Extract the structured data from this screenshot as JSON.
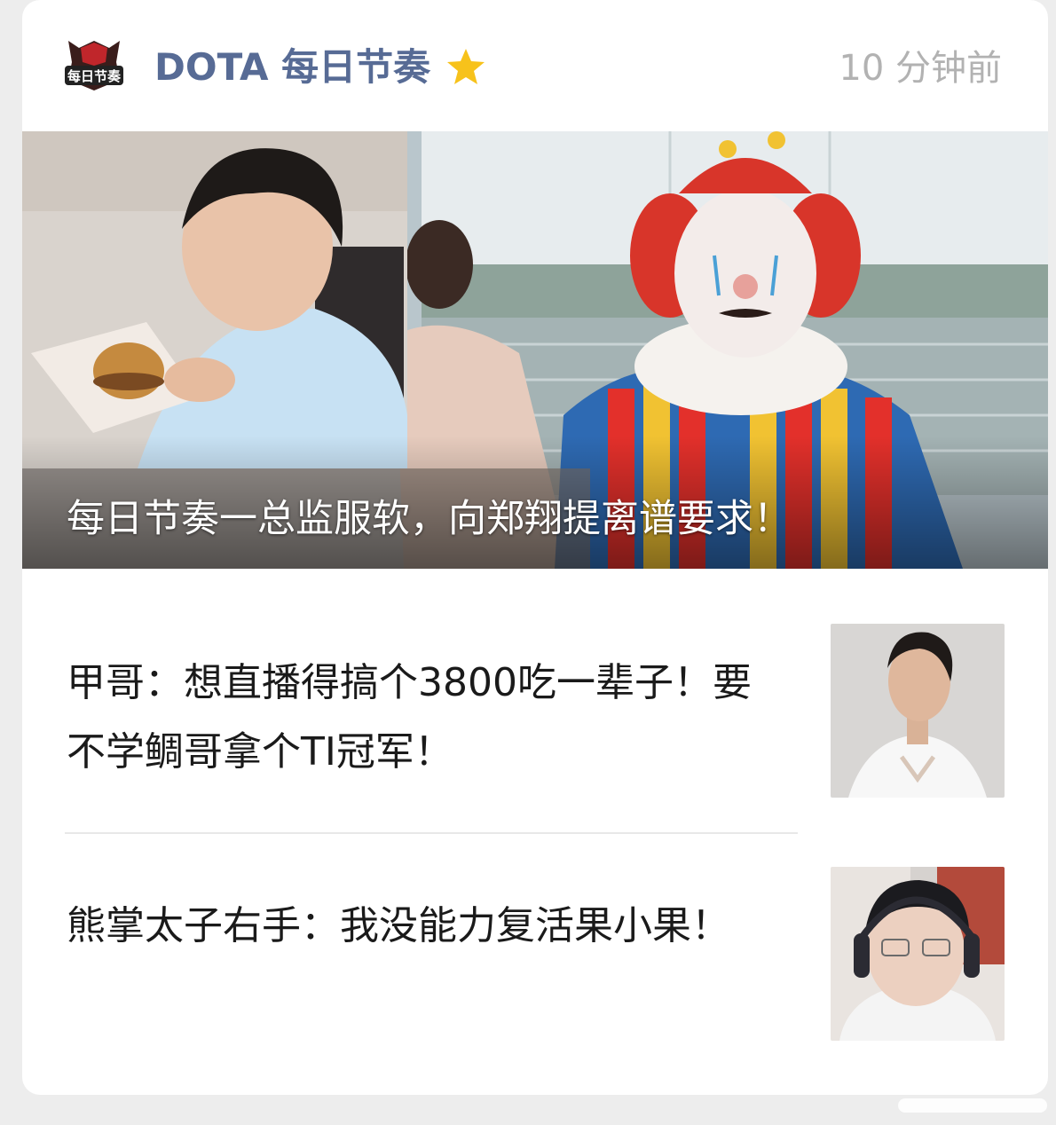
{
  "header": {
    "account_name": "DOTA 每日节奏",
    "time": "10 分钟前",
    "logo_text": "每日节奏"
  },
  "hero": {
    "title": "每日节奏一总监服软，向郑翔提离谱要求！"
  },
  "articles": [
    {
      "title": "甲哥：想直播得搞个3800吃一辈子！要不学鲷哥拿个TI冠军！"
    },
    {
      "title": "熊掌太子右手：我没能力复活果小果！"
    }
  ],
  "colors": {
    "account_name": "#576b95",
    "star": "#f7c21b",
    "time": "#b2b2b2"
  }
}
